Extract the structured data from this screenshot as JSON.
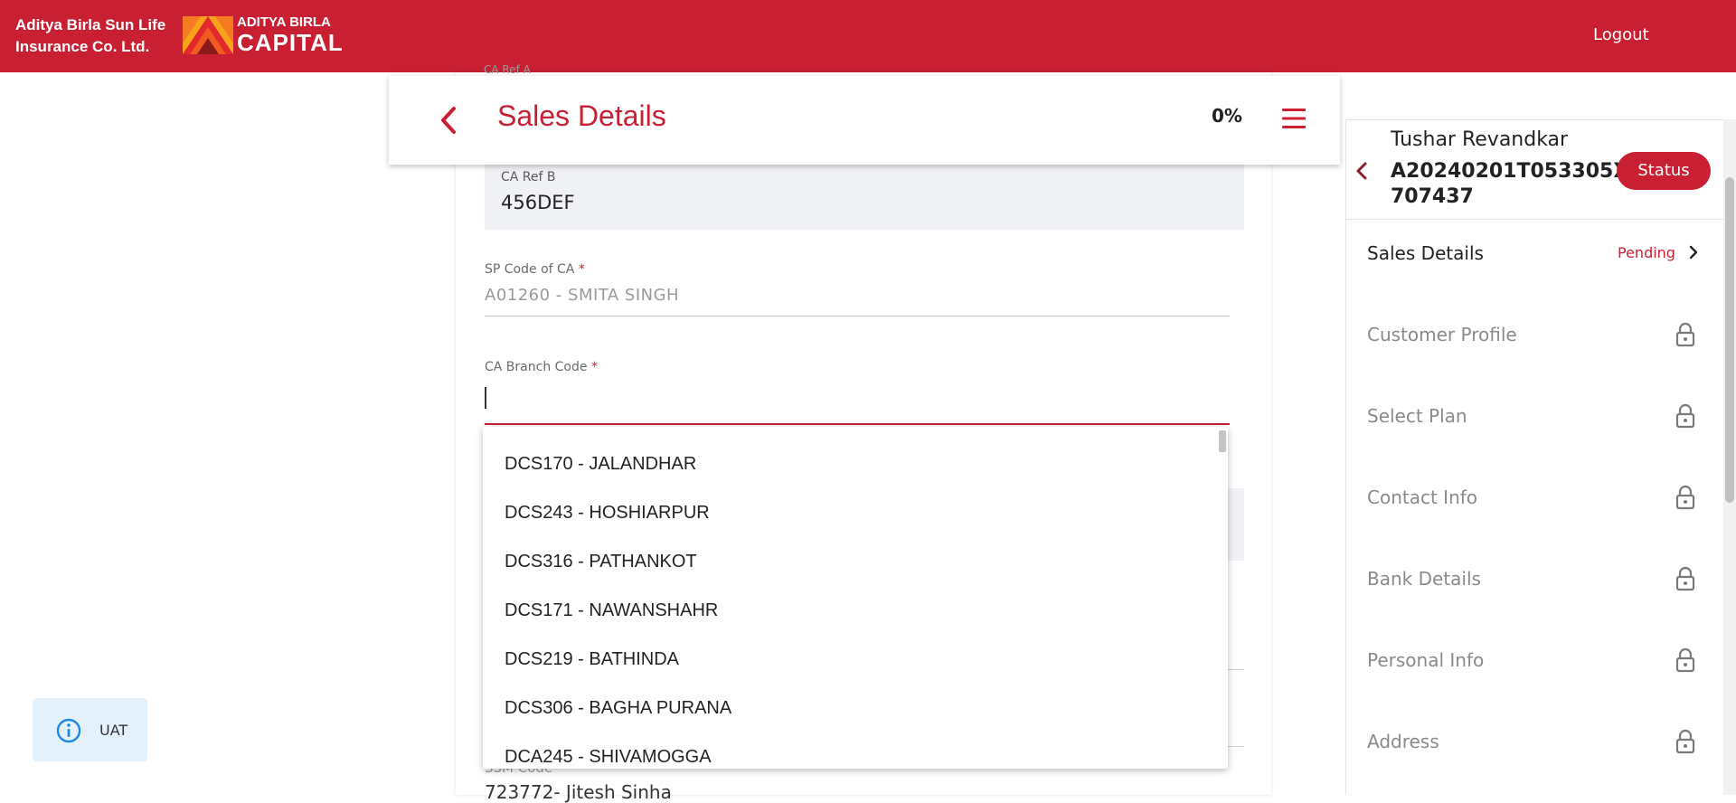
{
  "header": {
    "brand_line1": "Aditya Birla Sun Life",
    "brand_line2": "Insurance Co. Ltd.",
    "logo_line1": "ADITYA BIRLA",
    "logo_line2": "CAPITAL",
    "logout_label": "Logout",
    "brand_color": "#c91f33"
  },
  "page": {
    "title": "Sales Details",
    "progress_text": "0%",
    "progress_fraction": 0
  },
  "form": {
    "ghost_top_label": "CA Ref A",
    "ca_ref_b": {
      "label": "CA Ref B",
      "value": "456DEF"
    },
    "sp_code": {
      "label": "SP Code of CA",
      "required_mark": "*",
      "value": "A01260 - SMITA  SINGH"
    },
    "branch_code": {
      "label": "CA Branch Code",
      "required_mark": "*",
      "value": ""
    },
    "ssm_code": {
      "label": "SSM Code",
      "value": "723772- Jitesh Sinha"
    }
  },
  "dropdown": {
    "options": [
      "DCS170 - JALANDHAR",
      "DCS243 - HOSHIARPUR",
      "DCS316 - PATHANKOT",
      "DCS171 - NAWANSHAHR",
      "DCS219 - BATHINDA",
      "DCS306 - BAGHA PURANA",
      "DCA245 - SHIVAMOGGA"
    ]
  },
  "uat": {
    "label": "UAT",
    "icon": "info-icon"
  },
  "sidebar": {
    "customer_name": "Tushar Revandkar",
    "app_id_line1": "A20240201T053305X",
    "app_id_line2": "707437",
    "status_label": "Status",
    "steps": [
      {
        "name": "Sales Details",
        "status": "Pending",
        "locked": false,
        "active": true
      },
      {
        "name": "Customer Profile",
        "status": "",
        "locked": true,
        "active": false
      },
      {
        "name": "Select Plan",
        "status": "",
        "locked": true,
        "active": false
      },
      {
        "name": "Contact Info",
        "status": "",
        "locked": true,
        "active": false
      },
      {
        "name": "Bank Details",
        "status": "",
        "locked": true,
        "active": false
      },
      {
        "name": "Personal Info",
        "status": "",
        "locked": true,
        "active": false
      },
      {
        "name": "Address",
        "status": "",
        "locked": true,
        "active": false
      }
    ]
  }
}
